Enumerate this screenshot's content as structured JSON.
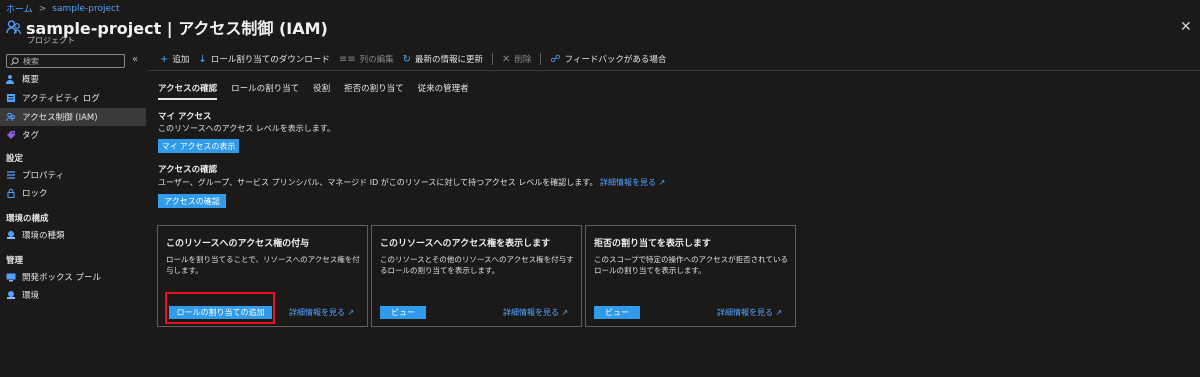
{
  "breadcrumb": {
    "home": "ホーム",
    "project": "sample-project"
  },
  "header": {
    "title": "sample-project | アクセス制御 (IAM)",
    "subtitle": "プロジェクト",
    "more": "…",
    "close": "✕"
  },
  "sidebar": {
    "search_placeholder": "検索",
    "collapse": "«",
    "items": [
      {
        "label": "概要"
      },
      {
        "label": "アクティビティ ログ"
      },
      {
        "label": "アクセス制御 (IAM)"
      },
      {
        "label": "タグ"
      }
    ],
    "sections": [
      {
        "title": "設定",
        "items": [
          {
            "label": "プロパティ"
          },
          {
            "label": "ロック"
          }
        ]
      },
      {
        "title": "環境の構成",
        "items": [
          {
            "label": "環境の種類"
          }
        ]
      },
      {
        "title": "管理",
        "items": [
          {
            "label": "開発ボックス プール"
          },
          {
            "label": "環境"
          }
        ]
      }
    ]
  },
  "toolbar": {
    "add": "追加",
    "download": "ロール割り当てのダウンロード",
    "edit_columns": "列の編集",
    "refresh": "最新の情報に更新",
    "delete": "削除",
    "feedback": "フィードバックがある場合"
  },
  "tabs": [
    {
      "label": "アクセスの確認",
      "active": true
    },
    {
      "label": "ロールの割り当て"
    },
    {
      "label": "役割"
    },
    {
      "label": "拒否の割り当て"
    },
    {
      "label": "従来の管理者"
    }
  ],
  "my_access": {
    "title": "マイ アクセス",
    "desc": "このリソースへのアクセス レベルを表示します。",
    "button": "マイ アクセスの表示"
  },
  "check_access": {
    "title": "アクセスの確認",
    "desc": "ユーザー、グループ、サービス プリンシパル、マネージド ID がこのリソースに対して持つアクセス レベルを確認します。",
    "link": "詳細情報を見る",
    "button": "アクセスの確認"
  },
  "cards": [
    {
      "title": "このリソースへのアクセス権の付与",
      "desc": "ロールを割り当てることで、リソースへのアクセス権を付与します。",
      "button": "ロールの割り当ての追加",
      "link": "詳細情報を見る"
    },
    {
      "title": "このリソースへのアクセス権を表示します",
      "desc": "このリソースとその他のリソースへのアクセス権を付与するロールの割り当てを表示します。",
      "button": "ビュー",
      "link": "詳細情報を見る"
    },
    {
      "title": "拒否の割り当てを表示します",
      "desc": "このスコープで特定の操作へのアクセスが拒否されているロールの割り当てを表示します。",
      "button": "ビュー",
      "link": "詳細情報を見る"
    }
  ],
  "colors": {
    "accent": "#2f9bea",
    "link": "#4fa3ff",
    "highlight": "#e81123",
    "background": "#1b1a19"
  }
}
